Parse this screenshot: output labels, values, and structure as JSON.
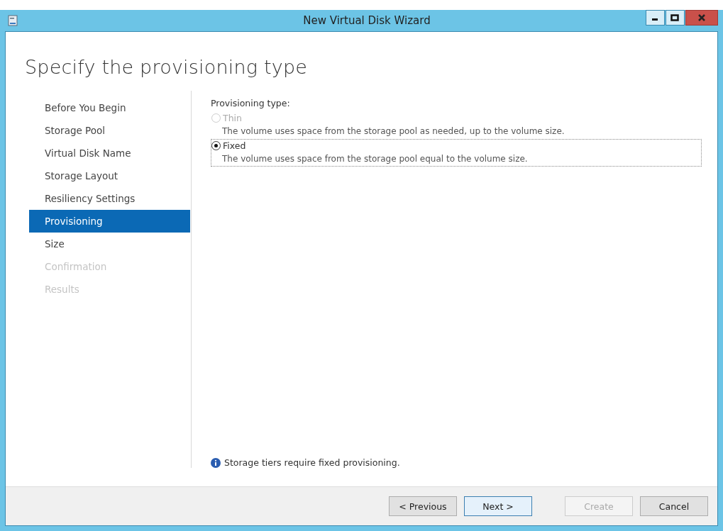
{
  "window": {
    "title": "New Virtual Disk Wizard"
  },
  "heading": "Specify the provisioning type",
  "steps": [
    {
      "label": "Before You Begin",
      "selected": false,
      "disabled": false
    },
    {
      "label": "Storage Pool",
      "selected": false,
      "disabled": false
    },
    {
      "label": "Virtual Disk Name",
      "selected": false,
      "disabled": false
    },
    {
      "label": "Storage Layout",
      "selected": false,
      "disabled": false
    },
    {
      "label": "Resiliency Settings",
      "selected": false,
      "disabled": false
    },
    {
      "label": "Provisioning",
      "selected": true,
      "disabled": false
    },
    {
      "label": "Size",
      "selected": false,
      "disabled": false
    },
    {
      "label": "Confirmation",
      "selected": false,
      "disabled": true
    },
    {
      "label": "Results",
      "selected": false,
      "disabled": true
    }
  ],
  "provisioning": {
    "label": "Provisioning type:",
    "options": [
      {
        "label": "Thin",
        "description": "The volume uses space from the storage pool as needed, up to the volume size.",
        "selected": false,
        "disabled": true,
        "focused": false
      },
      {
        "label": "Fixed",
        "description": "The volume uses space from the storage pool equal to the volume size.",
        "selected": true,
        "disabled": false,
        "focused": true
      }
    ]
  },
  "info": "Storage tiers require fixed provisioning.",
  "buttons": [
    {
      "label": "< Previous",
      "default": false,
      "disabled": false
    },
    {
      "label": "Next >",
      "default": true,
      "disabled": false
    },
    {
      "label": "Create",
      "default": false,
      "disabled": true
    },
    {
      "label": "Cancel",
      "default": false,
      "disabled": false
    }
  ]
}
